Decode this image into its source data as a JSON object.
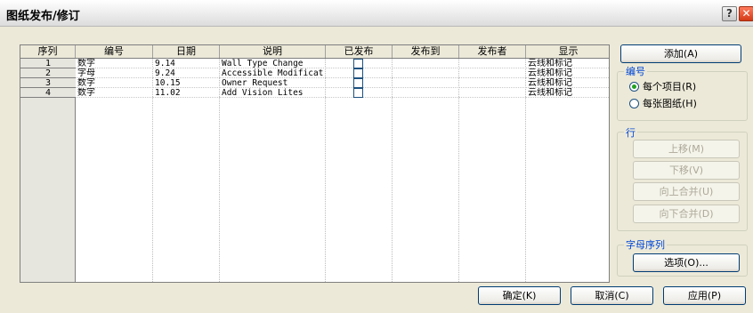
{
  "window": {
    "title": "图纸发布/修订",
    "help": "?",
    "close": "✕"
  },
  "grid": {
    "headers": [
      "序列",
      "编号",
      "日期",
      "说明",
      "已发布",
      "发布到",
      "发布者",
      "显示"
    ],
    "rows": [
      {
        "seq": "1",
        "numbering": "数字",
        "date": "9.14",
        "description": "Wall Type Change",
        "issued": false,
        "issued_to": "",
        "issued_by": "",
        "show": "云线和标记"
      },
      {
        "seq": "2",
        "numbering": "字母",
        "date": "9.24",
        "description": "Accessible Modificat",
        "issued": false,
        "issued_to": "",
        "issued_by": "",
        "show": "云线和标记"
      },
      {
        "seq": "3",
        "numbering": "数字",
        "date": "10.15",
        "description": "Owner Request",
        "issued": false,
        "issued_to": "",
        "issued_by": "",
        "show": "云线和标记"
      },
      {
        "seq": "4",
        "numbering": "数字",
        "date": "11.02",
        "description": "Add Vision Lites",
        "issued": false,
        "issued_to": "",
        "issued_by": "",
        "show": "云线和标记"
      }
    ]
  },
  "side": {
    "add": "添加(A)",
    "numbering_group": "编号",
    "radio_per_project": "每个项目(R)",
    "radio_per_sheet": "每张图纸(H)",
    "per_project_selected": true,
    "row_group": "行",
    "move_up": "上移(M)",
    "move_down": "下移(V)",
    "merge_up": "向上合并(U)",
    "merge_down": "向下合并(D)",
    "alpha_group": "字母序列",
    "options": "选项(O)..."
  },
  "footer": {
    "ok": "确定(K)",
    "cancel": "取消(C)",
    "apply": "应用(P)"
  }
}
